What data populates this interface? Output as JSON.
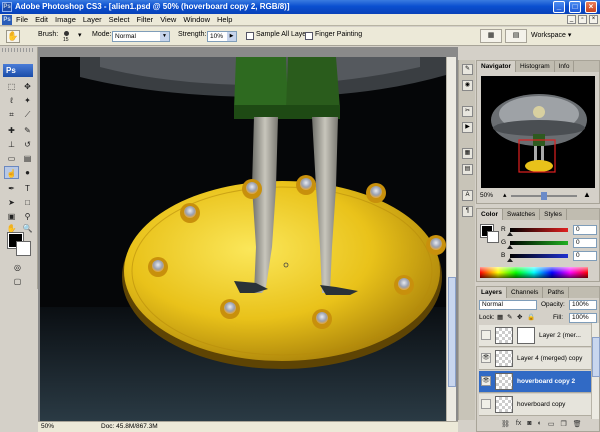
{
  "window": {
    "title": "Adobe Photoshop CS3 - [alien1.psd @ 50% (hoverboard copy 2, RGB/8)]",
    "app_icon": "Ps"
  },
  "menu": {
    "items": [
      "File",
      "Edit",
      "Image",
      "Layer",
      "Select",
      "Filter",
      "View",
      "Window",
      "Help"
    ]
  },
  "options": {
    "brush_label": "Brush:",
    "brush_size": "15",
    "mode_label": "Mode:",
    "mode_value": "Normal",
    "strength_label": "Strength:",
    "strength_value": "10%",
    "sample_all_layers": "Sample All Layers",
    "finger_painting": "Finger Painting",
    "workspace_label": "Workspace ▾"
  },
  "tools": {
    "badge": "Ps",
    "icons": [
      "marquee-icon",
      "move-icon",
      "lasso-icon",
      "magic-wand-icon",
      "crop-icon",
      "slice-icon",
      "healing-icon",
      "brush-icon",
      "stamp-icon",
      "history-brush-icon",
      "eraser-icon",
      "gradient-icon",
      "smudge-icon",
      "dodge-icon",
      "pen-icon",
      "type-icon",
      "path-select-icon",
      "shape-icon",
      "notes-icon",
      "eyedropper-icon",
      "hand-icon",
      "zoom-icon"
    ],
    "foreground": "#000000",
    "background": "#ffffff"
  },
  "status": {
    "zoom": "50%",
    "doc": "Doc: 45.8M/867.3M"
  },
  "navigator": {
    "tabs": [
      "Navigator",
      "Histogram",
      "Info"
    ],
    "zoom": "50%"
  },
  "color": {
    "tabs": [
      "Color",
      "Swatches",
      "Styles"
    ],
    "channels": [
      {
        "label": "R",
        "value": "0",
        "color": "#e02020"
      },
      {
        "label": "G",
        "value": "0",
        "color": "#20b020"
      },
      {
        "label": "B",
        "value": "0",
        "color": "#2030d0"
      }
    ]
  },
  "layers": {
    "tabs": [
      "Layers",
      "Channels",
      "Paths"
    ],
    "blend_mode": "Normal",
    "opacity_label": "Opacity:",
    "opacity_value": "100%",
    "lock_label": "Lock:",
    "fill_label": "Fill:",
    "fill_value": "100%",
    "items": [
      {
        "name": "Layer 2 (mer...",
        "visible": false,
        "selected": false
      },
      {
        "name": "Layer 4 (merged) copy",
        "visible": true,
        "selected": false
      },
      {
        "name": "hoverboard copy 2",
        "visible": true,
        "selected": true
      },
      {
        "name": "hoverboard copy",
        "visible": false,
        "selected": false
      }
    ]
  }
}
